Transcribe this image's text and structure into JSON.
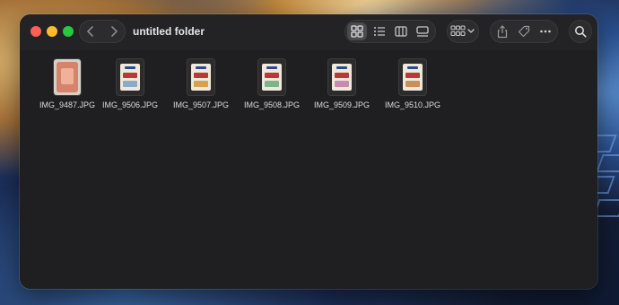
{
  "window": {
    "title": "untitled folder"
  },
  "toolbar": {
    "back_icon": "chevron-left-icon",
    "forward_icon": "chevron-right-icon",
    "view_modes": [
      "icon-view-icon",
      "list-view-icon",
      "column-view-icon",
      "gallery-view-icon"
    ],
    "active_view": "icon-view-icon",
    "group_icon": "group-icon",
    "actions": [
      "share-icon",
      "tag-icon",
      "more-icon"
    ],
    "search_icon": "search-icon"
  },
  "files": [
    {
      "name": "IMG_9487.JPG",
      "thumb": "photo"
    },
    {
      "name": "IMG_9506.JPG",
      "thumb": "card",
      "accent": "#8fa9c8"
    },
    {
      "name": "IMG_9507.JPG",
      "thumb": "card",
      "accent": "#d6a24a"
    },
    {
      "name": "IMG_9508.JPG",
      "thumb": "card",
      "accent": "#7fb38a"
    },
    {
      "name": "IMG_9509.JPG",
      "thumb": "card",
      "accent": "#c98ab0"
    },
    {
      "name": "IMG_9510.JPG",
      "thumb": "card",
      "accent": "#c9905a"
    }
  ],
  "colors": {
    "close": "#ff5f57",
    "minimize": "#febc2e",
    "maximize": "#28c840",
    "window_bg": "#1f1f21"
  }
}
